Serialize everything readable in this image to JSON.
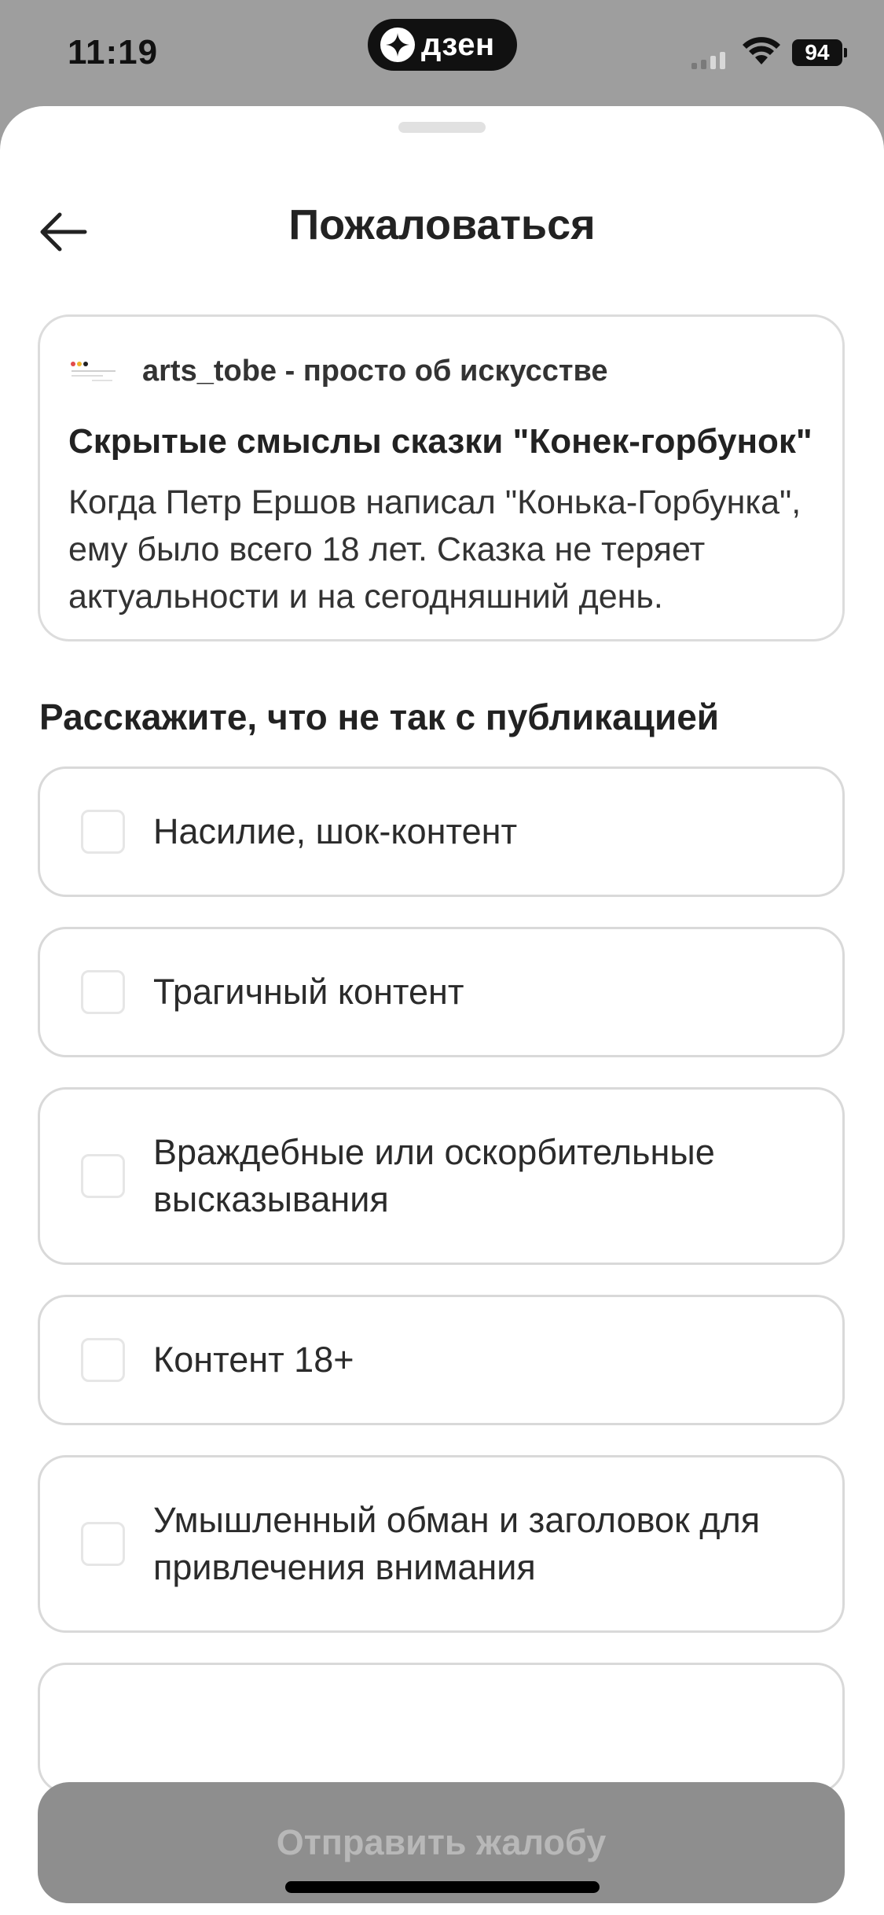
{
  "status_bar": {
    "time": "11:19",
    "brand": "дзен",
    "battery": "94"
  },
  "header": {
    "title": "Пожаловаться"
  },
  "article": {
    "channel": "arts_tobe - просто об искусстве",
    "title": "Скрытые смыслы сказки \"Конек-горбунок\"",
    "excerpt": "Когда Петр Ершов написал \"Конька-Горбунка\", ему было всего 18 лет. Сказка не теряет актуальности и на сегодняшний день."
  },
  "form": {
    "heading": "Расскажите, что не так с публикацией",
    "options": [
      {
        "label": "Насилие, шок-контент",
        "checked": false
      },
      {
        "label": "Трагичный контент",
        "checked": false
      },
      {
        "label": "Враждебные или оскорбительные высказывания",
        "checked": false
      },
      {
        "label": "Контент 18+",
        "checked": false
      },
      {
        "label": "Умышленный обман и заголовок для привлечения внимания",
        "checked": false
      }
    ],
    "submit_label": "Отправить жалобу"
  },
  "colors": {
    "sheet_background": "#ffffff",
    "overlay_background": "#9e9e9e",
    "submit_disabled_background": "#8e8e8e",
    "submit_disabled_text": "#b8b8b8"
  }
}
